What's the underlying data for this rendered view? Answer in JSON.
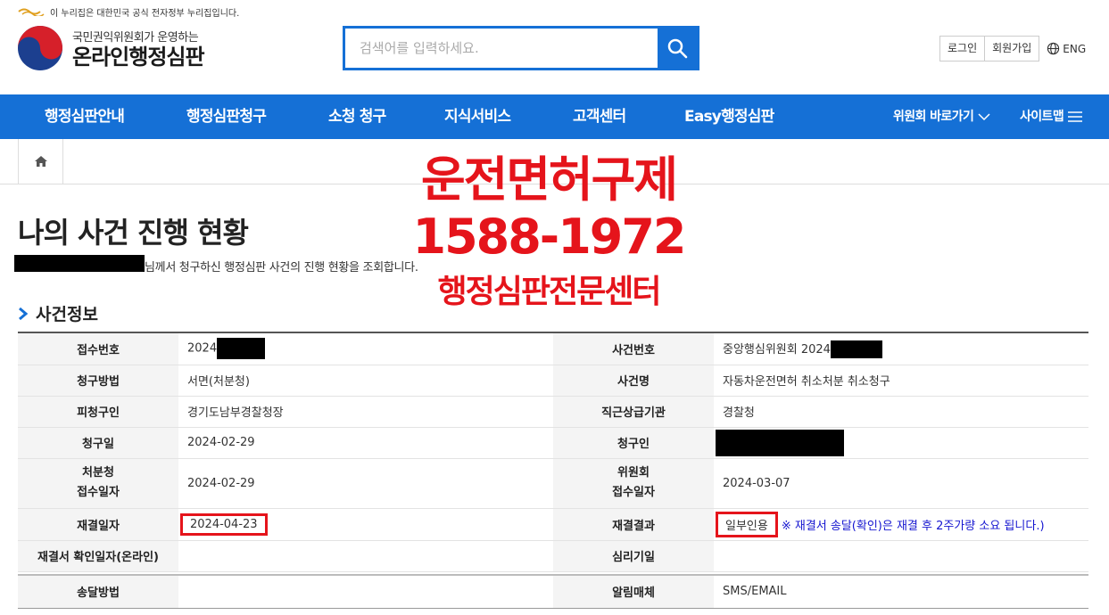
{
  "gov_notice": "이 누리집은 대한민국 공식 전자정부 누리집입니다.",
  "logo": {
    "sub": "국민권익위원회가 운영하는",
    "main": "온라인행정심판"
  },
  "search": {
    "placeholder": "검색어를 입력하세요."
  },
  "util": {
    "login": "로그인",
    "join": "회원가입",
    "lang": "ENG"
  },
  "gnb": {
    "items": [
      "행정심판안내",
      "행정심판청구",
      "소청 청구",
      "지식서비스",
      "고객센터",
      "Easy행정심판"
    ],
    "committee": "위원회 바로가기",
    "sitemap": "사이트맵"
  },
  "page": {
    "title": "나의 사건 진행 현황",
    "intro": "님께서 청구하신 행정심판 사건의 진행 현황을 조회합니다."
  },
  "overlay": {
    "line1": "운전면허구제",
    "line2": "1588-1972",
    "line3": "행정심판전문센터"
  },
  "section": {
    "title": "사건정보"
  },
  "rows": {
    "r1": {
      "l1": "접수번호",
      "v1": "2024",
      "l2": "사건번호",
      "v2": "중앙행심위원회 2024"
    },
    "r2": {
      "l1": "청구방법",
      "v1": "서면(처분청)",
      "l2": "사건명",
      "v2": "자동차운전면허 취소처분 취소청구"
    },
    "r3": {
      "l1": "피청구인",
      "v1": "경기도남부경찰청장",
      "l2": "직근상급기관",
      "v2": "경찰청"
    },
    "r4": {
      "l1": "청구일",
      "v1": "2024-02-29",
      "l2": "청구인",
      "v2": ""
    },
    "r5": {
      "l1a": "처분청",
      "l1b": "접수일자",
      "v1": "2024-02-29",
      "l2a": "위원회",
      "l2b": "접수일자",
      "v2": "2024-03-07"
    },
    "r6": {
      "l1": "재결일자",
      "v1": "2024-04-23",
      "l2": "재결결과",
      "v2": "일부인용",
      "notice": "※ 재결서 송달(확인)은 재결 후 2주가량 소요 됩니다.)"
    },
    "r7": {
      "l1": "재결서 확인일자(온라인)",
      "v1": "",
      "l2": "심리기일",
      "v2": ""
    },
    "r8": {
      "l1": "송달방법",
      "v1": "",
      "l2": "알림매체",
      "v2": "SMS/EMAIL"
    }
  },
  "colors": {
    "brand_blue": "#1570d6",
    "highlight_red": "#e5141b",
    "notice_blue": "#1515d0"
  }
}
